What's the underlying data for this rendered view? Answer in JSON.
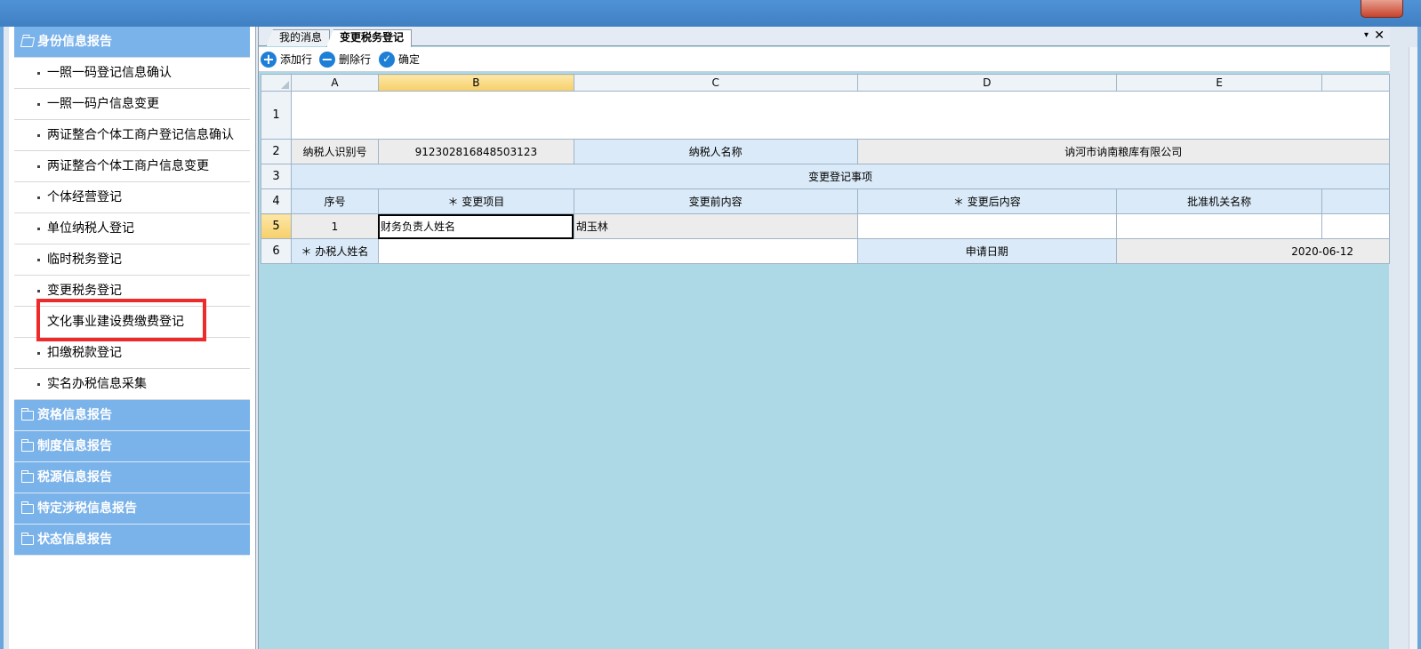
{
  "sidebar": {
    "groups": [
      {
        "label": "身份信息报告",
        "expanded": true,
        "items": [
          "一照一码登记信息确认",
          "一照一码户信息变更",
          "两证整合个体工商户登记信息确认",
          "两证整合个体工商户信息变更",
          "个体经营登记",
          "单位纳税人登记",
          "临时税务登记",
          "变更税务登记",
          "文化事业建设费缴费登记",
          "扣缴税款登记",
          "实名办税信息采集"
        ],
        "highlighted_item": "变更税务登记"
      },
      {
        "label": "资格信息报告",
        "expanded": false
      },
      {
        "label": "制度信息报告",
        "expanded": false
      },
      {
        "label": "税源信息报告",
        "expanded": false
      },
      {
        "label": "特定涉税信息报告",
        "expanded": false
      },
      {
        "label": "状态信息报告",
        "expanded": false
      }
    ]
  },
  "tabs": [
    {
      "label": "我的消息",
      "active": false
    },
    {
      "label": "变更税务登记",
      "active": true
    }
  ],
  "tab_controls": {
    "menu": "▾",
    "close": "✕"
  },
  "toolbar": {
    "add_row": "添加行",
    "delete_row": "删除行",
    "confirm": "确定"
  },
  "grid": {
    "columns": [
      "A",
      "B",
      "C",
      "D",
      "E"
    ],
    "selected_column": "B",
    "selected_row": "5",
    "row_numbers": [
      "1",
      "2",
      "3",
      "4",
      "5",
      "6"
    ],
    "taxpayer_id_label": "纳税人识别号",
    "taxpayer_id": "912302816848503123",
    "taxpayer_name_label": "纳税人名称",
    "taxpayer_name": "讷河市讷南粮库有限公司",
    "section_title": "变更登记事项",
    "headers": {
      "seq": "序号",
      "change_item": "＊ 变更项目",
      "before": "变更前内容",
      "after": "＊ 变更后内容",
      "authority": "批准机关名称"
    },
    "row5": {
      "seq": "1",
      "change_item": "财务负责人姓名",
      "before": "胡玉林",
      "after": "",
      "authority": ""
    },
    "handler_label": "＊ 办税人姓名",
    "handler_value": "",
    "apply_date_label": "申请日期",
    "apply_date": "2020-06-12"
  },
  "colors": {
    "sidebar_header": "#7ab2ea",
    "content_background": "#add8e6",
    "highlight_box": "#ee2a2a",
    "toolbar_icon": "#1e7fd6"
  }
}
